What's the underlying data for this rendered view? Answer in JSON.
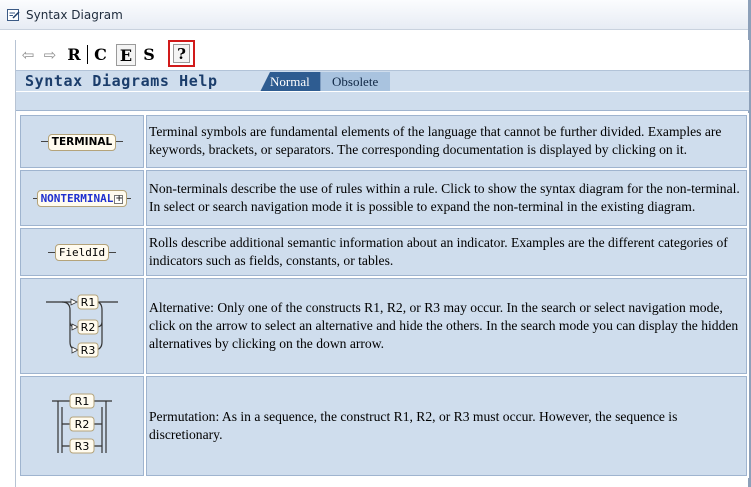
{
  "window": {
    "title": "Syntax Diagram"
  },
  "toolbar": {
    "back_icon": "arrow-left-icon",
    "forward_icon": "arrow-right-icon",
    "r_label": "R",
    "c_label": "C",
    "e_label": "E",
    "s_label": "S",
    "help_label": "?"
  },
  "header": {
    "title": "Syntax Diagrams Help",
    "tabs": [
      {
        "label": "Normal",
        "active": true
      },
      {
        "label": "Obsolete",
        "active": false
      }
    ]
  },
  "rows": [
    {
      "symbol": "TERMINAL",
      "description": "Terminal symbols are fundamental elements of the language that cannot be further divided. Examples are keywords, brackets, or separators. The corresponding documentation is displayed by clicking on it."
    },
    {
      "symbol": "NONTERMINAL",
      "description": "Non-terminals describe the use of rules within a rule. Click to show the syntax diagram for the non-terminal. In select or search navigation mode it is possible to expand the non-terminal in the existing diagram."
    },
    {
      "symbol": "FieldId",
      "description": "Rolls describe additional semantic information about an indicator. Examples are the different categories of indicators such as fields, constants, or tables."
    },
    {
      "symbol_items": [
        "R1",
        "R2",
        "R3"
      ],
      "description": "Alternative: Only one of the constructs R1, R2, or R3 may occur. In the search or select navigation mode, click on the arrow to select an alternative and hide the others. In the search mode you can display the hidden alternatives by clicking on the down arrow."
    },
    {
      "symbol_items": [
        "R1",
        "R2",
        "R3"
      ],
      "description": "Permutation: As in a sequence, the construct R1, R2, or R3 must occur. However, the sequence is discretionary."
    }
  ],
  "colors": {
    "panel": "#cfdded",
    "border": "#9fb4cf",
    "title": "#1b3d6b",
    "tab_active": "#2e5c91",
    "tab_inactive": "#a9c3df",
    "nonterminal_text": "#1f2fcf",
    "help_highlight": "#d11a1a"
  }
}
